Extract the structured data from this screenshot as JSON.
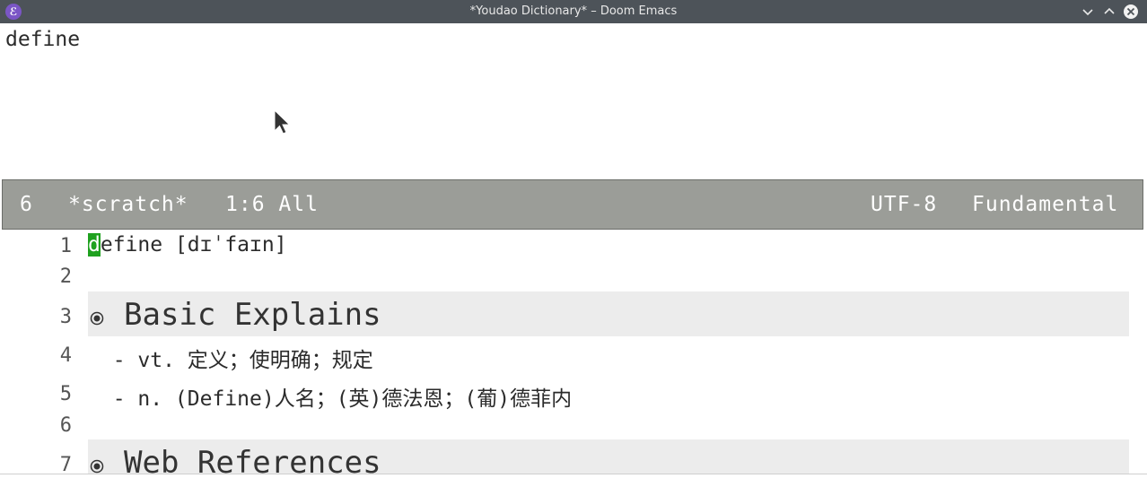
{
  "window": {
    "title": "*Youdao Dictionary* – Doom Emacs",
    "app_icon": "emacs-icon",
    "app_icon_glyph": "ℰ",
    "controls": [
      "minimize-icon",
      "maximize-icon",
      "close-icon"
    ]
  },
  "minibuffer": {
    "text": "define"
  },
  "modeline": {
    "number": "6",
    "buffer": "*scratch*",
    "position": "1:6 All",
    "encoding": "UTF-8",
    "mode": "Fundamental"
  },
  "buffer": {
    "lines": [
      {
        "num": "1",
        "point_char": "d",
        "text": "efine [dɪˈfaɪn]"
      },
      {
        "num": "2"
      },
      {
        "num": "3",
        "heading": "Basic Explains"
      },
      {
        "num": "4",
        "text": "  - vt. 定义；使明确；规定"
      },
      {
        "num": "5",
        "text": "  - n. (Define)人名；(英)德法恩；(葡)德菲内"
      },
      {
        "num": "6"
      },
      {
        "num": "7",
        "heading": "Web References"
      }
    ]
  },
  "colors": {
    "titlebar": "#4d5359",
    "modeline": "#9b9d98",
    "cursor_point": "#1fa11f",
    "heading_bg": "#ececec"
  }
}
